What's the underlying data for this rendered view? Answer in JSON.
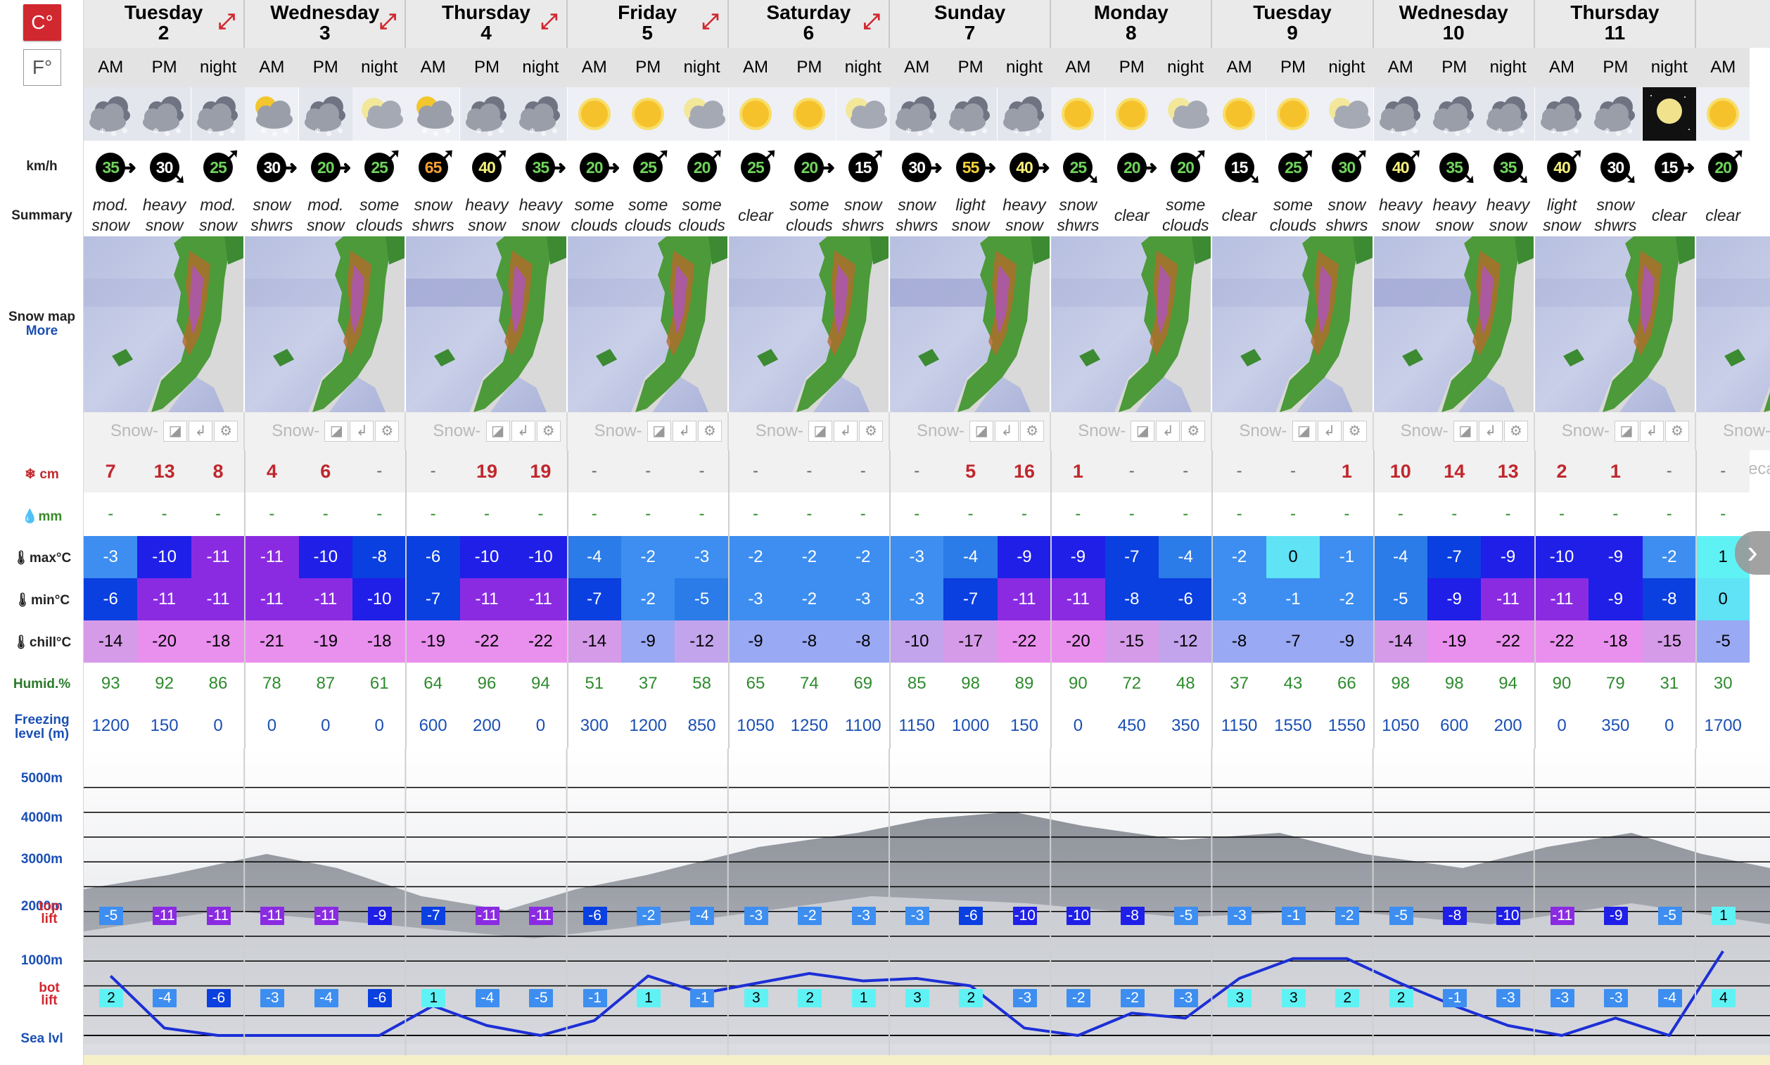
{
  "units": {
    "celsius": "C°",
    "fahrenheit": "F°"
  },
  "labels": {
    "wind": "km/h",
    "summary": "Summary",
    "snowmap": "Snow map",
    "more": "More",
    "snow": "cm",
    "rain": "mm",
    "max": "max°C",
    "min": "min°C",
    "chill": "chill°C",
    "humid": "Humid.%",
    "freezing1": "Freezing",
    "freezing2": "level (m)",
    "top1": "top",
    "top2": "lift",
    "bot1": "bot",
    "bot2": "lift",
    "sea": "Sea lvl"
  },
  "watermark": "Snow-Forecast.com",
  "elev_labels": [
    "5000m",
    "4000m",
    "3000m",
    "2000m",
    "1000m"
  ],
  "days": [
    {
      "name": "Tuesday",
      "num": "2",
      "expand": true
    },
    {
      "name": "Wednesday",
      "num": "3",
      "expand": true
    },
    {
      "name": "Thursday",
      "num": "4",
      "expand": true
    },
    {
      "name": "Friday",
      "num": "5",
      "expand": true
    },
    {
      "name": "Saturday",
      "num": "6",
      "expand": true
    },
    {
      "name": "Sunday",
      "num": "7",
      "expand": false
    },
    {
      "name": "Monday",
      "num": "8",
      "expand": false
    },
    {
      "name": "Tuesday",
      "num": "9",
      "expand": false
    },
    {
      "name": "Wednesday",
      "num": "10",
      "expand": false
    },
    {
      "name": "Thursday",
      "num": "11",
      "expand": false
    },
    {
      "name": "",
      "num": "",
      "expand": false
    }
  ],
  "periods": [
    "AM",
    "PM",
    "night",
    "AM",
    "PM",
    "night",
    "AM",
    "PM",
    "night",
    "AM",
    "PM",
    "night",
    "AM",
    "PM",
    "night",
    "AM",
    "PM",
    "night",
    "AM",
    "PM",
    "night",
    "AM",
    "PM",
    "night",
    "AM",
    "PM",
    "night",
    "AM",
    "PM",
    "night",
    "AM"
  ],
  "weather": [
    "snow",
    "snow",
    "snow",
    "sun-snow",
    "snow",
    "moon",
    "sun-snow",
    "snow",
    "snow",
    "sun",
    "sun",
    "moon",
    "sun",
    "sun",
    "moon",
    "snow",
    "snow",
    "snow",
    "sun",
    "sun",
    "moon",
    "sun",
    "sun",
    "moon",
    "snow",
    "snow",
    "snow",
    "snow",
    "snow",
    "moonclear",
    "sun"
  ],
  "wind": [
    {
      "v": "35",
      "c": "#6fd35b",
      "d": "e"
    },
    {
      "v": "30",
      "c": "#fff",
      "d": "se"
    },
    {
      "v": "25",
      "c": "#6fd35b",
      "d": "ne"
    },
    {
      "v": "30",
      "c": "#fff",
      "d": "e"
    },
    {
      "v": "20",
      "c": "#6fd35b",
      "d": "e"
    },
    {
      "v": "25",
      "c": "#6fd35b",
      "d": "ne"
    },
    {
      "v": "65",
      "c": "#f7a136",
      "d": "ne"
    },
    {
      "v": "40",
      "c": "#f5ef7a",
      "d": "ne"
    },
    {
      "v": "35",
      "c": "#6fd35b",
      "d": "e"
    },
    {
      "v": "20",
      "c": "#6fd35b",
      "d": "e"
    },
    {
      "v": "25",
      "c": "#6fd35b",
      "d": "ne"
    },
    {
      "v": "20",
      "c": "#6fd35b",
      "d": "ne"
    },
    {
      "v": "25",
      "c": "#6fd35b",
      "d": "ne"
    },
    {
      "v": "20",
      "c": "#6fd35b",
      "d": "e"
    },
    {
      "v": "15",
      "c": "#fff",
      "d": "ne"
    },
    {
      "v": "30",
      "c": "#fff",
      "d": "e"
    },
    {
      "v": "55",
      "c": "#f5d23a",
      "d": "e"
    },
    {
      "v": "40",
      "c": "#f5ef7a",
      "d": "e"
    },
    {
      "v": "25",
      "c": "#6fd35b",
      "d": "se"
    },
    {
      "v": "20",
      "c": "#6fd35b",
      "d": "e"
    },
    {
      "v": "20",
      "c": "#6fd35b",
      "d": "ne"
    },
    {
      "v": "15",
      "c": "#fff",
      "d": "se"
    },
    {
      "v": "25",
      "c": "#6fd35b",
      "d": "ne"
    },
    {
      "v": "30",
      "c": "#6fd35b",
      "d": "ne"
    },
    {
      "v": "40",
      "c": "#f5ef7a",
      "d": "ne"
    },
    {
      "v": "35",
      "c": "#6fd35b",
      "d": "se"
    },
    {
      "v": "35",
      "c": "#6fd35b",
      "d": "se"
    },
    {
      "v": "40",
      "c": "#f5ef7a",
      "d": "ne"
    },
    {
      "v": "30",
      "c": "#fff",
      "d": "se"
    },
    {
      "v": "15",
      "c": "#fff",
      "d": "e"
    },
    {
      "v": "20",
      "c": "#6fd35b",
      "d": "ne"
    }
  ],
  "summary": [
    [
      "mod.",
      "snow"
    ],
    [
      "heavy",
      "snow"
    ],
    [
      "mod.",
      "snow"
    ],
    [
      "snow",
      "shwrs"
    ],
    [
      "mod.",
      "snow"
    ],
    [
      "some",
      "clouds"
    ],
    [
      "snow",
      "shwrs"
    ],
    [
      "heavy",
      "snow"
    ],
    [
      "heavy",
      "snow"
    ],
    [
      "some",
      "clouds"
    ],
    [
      "some",
      "clouds"
    ],
    [
      "some",
      "clouds"
    ],
    [
      "clear"
    ],
    [
      "some",
      "clouds"
    ],
    [
      "snow",
      "shwrs"
    ],
    [
      "snow",
      "shwrs"
    ],
    [
      "light",
      "snow"
    ],
    [
      "heavy",
      "snow"
    ],
    [
      "snow",
      "shwrs"
    ],
    [
      "clear"
    ],
    [
      "some",
      "clouds"
    ],
    [
      "clear"
    ],
    [
      "some",
      "clouds"
    ],
    [
      "snow",
      "shwrs"
    ],
    [
      "heavy",
      "snow"
    ],
    [
      "heavy",
      "snow"
    ],
    [
      "heavy",
      "snow"
    ],
    [
      "light",
      "snow"
    ],
    [
      "snow",
      "shwrs"
    ],
    [
      "clear"
    ],
    [
      "clear"
    ]
  ],
  "snow": [
    "7",
    "13",
    "8",
    "4",
    "6",
    "-",
    "-",
    "19",
    "19",
    "-",
    "-",
    "-",
    "-",
    "-",
    "-",
    "-",
    "5",
    "16",
    "1",
    "-",
    "-",
    "-",
    "-",
    "1",
    "10",
    "14",
    "13",
    "2",
    "1",
    "-",
    "-"
  ],
  "rain": [
    "-",
    "-",
    "-",
    "-",
    "-",
    "-",
    "-",
    "-",
    "-",
    "-",
    "-",
    "-",
    "-",
    "-",
    "-",
    "-",
    "-",
    "-",
    "-",
    "-",
    "-",
    "-",
    "-",
    "-",
    "-",
    "-",
    "-",
    "-",
    "-",
    "-",
    "-"
  ],
  "max": [
    "-3",
    "-10",
    "-11",
    "-11",
    "-10",
    "-8",
    "-6",
    "-10",
    "-10",
    "-4",
    "-2",
    "-3",
    "-2",
    "-2",
    "-2",
    "-3",
    "-4",
    "-9",
    "-9",
    "-7",
    "-4",
    "-2",
    "0",
    "-1",
    "-4",
    "-7",
    "-9",
    "-10",
    "-9",
    "-2",
    "1"
  ],
  "min": [
    "-6",
    "-11",
    "-11",
    "-11",
    "-11",
    "-10",
    "-7",
    "-11",
    "-11",
    "-7",
    "-2",
    "-5",
    "-3",
    "-2",
    "-3",
    "-3",
    "-7",
    "-11",
    "-11",
    "-8",
    "-6",
    "-3",
    "-1",
    "-2",
    "-5",
    "-9",
    "-11",
    "-11",
    "-9",
    "-8",
    "0"
  ],
  "chill": [
    "-14",
    "-20",
    "-18",
    "-21",
    "-19",
    "-18",
    "-19",
    "-22",
    "-22",
    "-14",
    "-9",
    "-12",
    "-9",
    "-8",
    "-8",
    "-10",
    "-17",
    "-22",
    "-20",
    "-15",
    "-12",
    "-8",
    "-7",
    "-9",
    "-14",
    "-19",
    "-22",
    "-22",
    "-18",
    "-15",
    "-5"
  ],
  "humid": [
    "93",
    "92",
    "86",
    "78",
    "87",
    "61",
    "64",
    "96",
    "94",
    "51",
    "37",
    "58",
    "65",
    "74",
    "69",
    "85",
    "98",
    "89",
    "90",
    "72",
    "48",
    "37",
    "43",
    "66",
    "98",
    "98",
    "94",
    "90",
    "79",
    "31",
    "30"
  ],
  "freezing": [
    1200,
    150,
    0,
    0,
    0,
    0,
    600,
    200,
    0,
    300,
    1200,
    850,
    1050,
    1250,
    1100,
    1150,
    1000,
    150,
    0,
    450,
    350,
    1150,
    1550,
    1550,
    1050,
    600,
    200,
    0,
    350,
    0,
    1700
  ],
  "toplift": [
    "-5",
    "-11",
    "-11",
    "-11",
    "-11",
    "-9",
    "-7",
    "-11",
    "-11",
    "-6",
    "-2",
    "-4",
    "-3",
    "-2",
    "-3",
    "-3",
    "-6",
    "-10",
    "-10",
    "-8",
    "-5",
    "-3",
    "-1",
    "-2",
    "-5",
    "-8",
    "-10",
    "-11",
    "-9",
    "-5",
    "1"
  ],
  "botlift": [
    "2",
    "-4",
    "-6",
    "-3",
    "-4",
    "-6",
    "1",
    "-4",
    "-5",
    "-1",
    "1",
    "-1",
    "3",
    "2",
    "1",
    "3",
    "2",
    "-3",
    "-2",
    "-2",
    "-3",
    "3",
    "3",
    "2",
    "2",
    "-1",
    "-3",
    "-3",
    "-3",
    "-4",
    "4"
  ]
}
